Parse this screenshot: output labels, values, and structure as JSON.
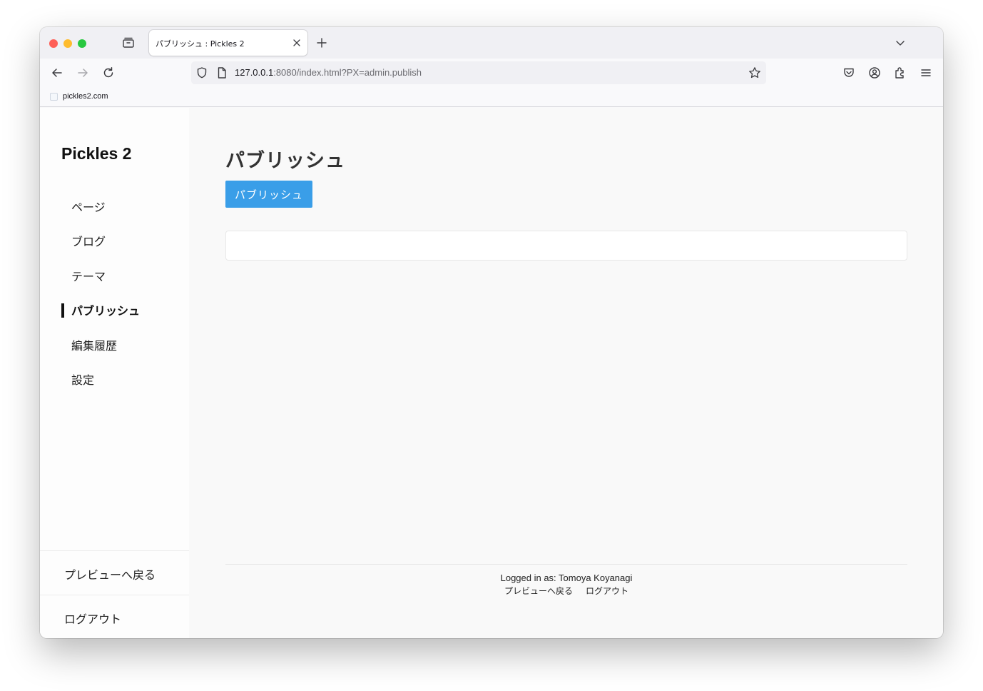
{
  "browser": {
    "tab": {
      "title": "パブリッシュ : Pickles 2"
    },
    "url": {
      "host": "127.0.0.1",
      "rest": ":8080/index.html?PX=admin.publish"
    },
    "bookmarks": [
      {
        "label": "pickles2.com"
      }
    ],
    "icons": {
      "tab_list": "tab-list-icon",
      "close": "close-icon",
      "new_tab": "plus-icon",
      "overflow": "chevron-down-icon",
      "back": "back-arrow-icon",
      "forward": "forward-arrow-icon",
      "reload": "reload-icon",
      "shield": "shield-icon",
      "page": "page-icon",
      "star": "star-icon",
      "pocket": "pocket-icon",
      "account": "account-icon",
      "extensions": "extensions-icon",
      "menu": "hamburger-menu-icon"
    }
  },
  "app": {
    "brand": "Pickles 2",
    "nav": [
      {
        "label": "ページ",
        "active": false
      },
      {
        "label": "ブログ",
        "active": false
      },
      {
        "label": "テーマ",
        "active": false
      },
      {
        "label": "パブリッシュ",
        "active": true
      },
      {
        "label": "編集履歴",
        "active": false
      },
      {
        "label": "設定",
        "active": false
      }
    ],
    "sidebar_bottom": {
      "preview_label": "プレビューへ戻る",
      "logout_label": "ログアウト"
    },
    "main": {
      "title": "パブリッシュ",
      "publish_button": "パブリッシュ"
    },
    "footer": {
      "logged_in": "Logged in as: Tomoya Koyanagi",
      "preview_link": "プレビューへ戻る",
      "logout_link": "ログアウト"
    },
    "colors": {
      "accent": "#3a9ee8",
      "active_bar": "#111111"
    }
  }
}
